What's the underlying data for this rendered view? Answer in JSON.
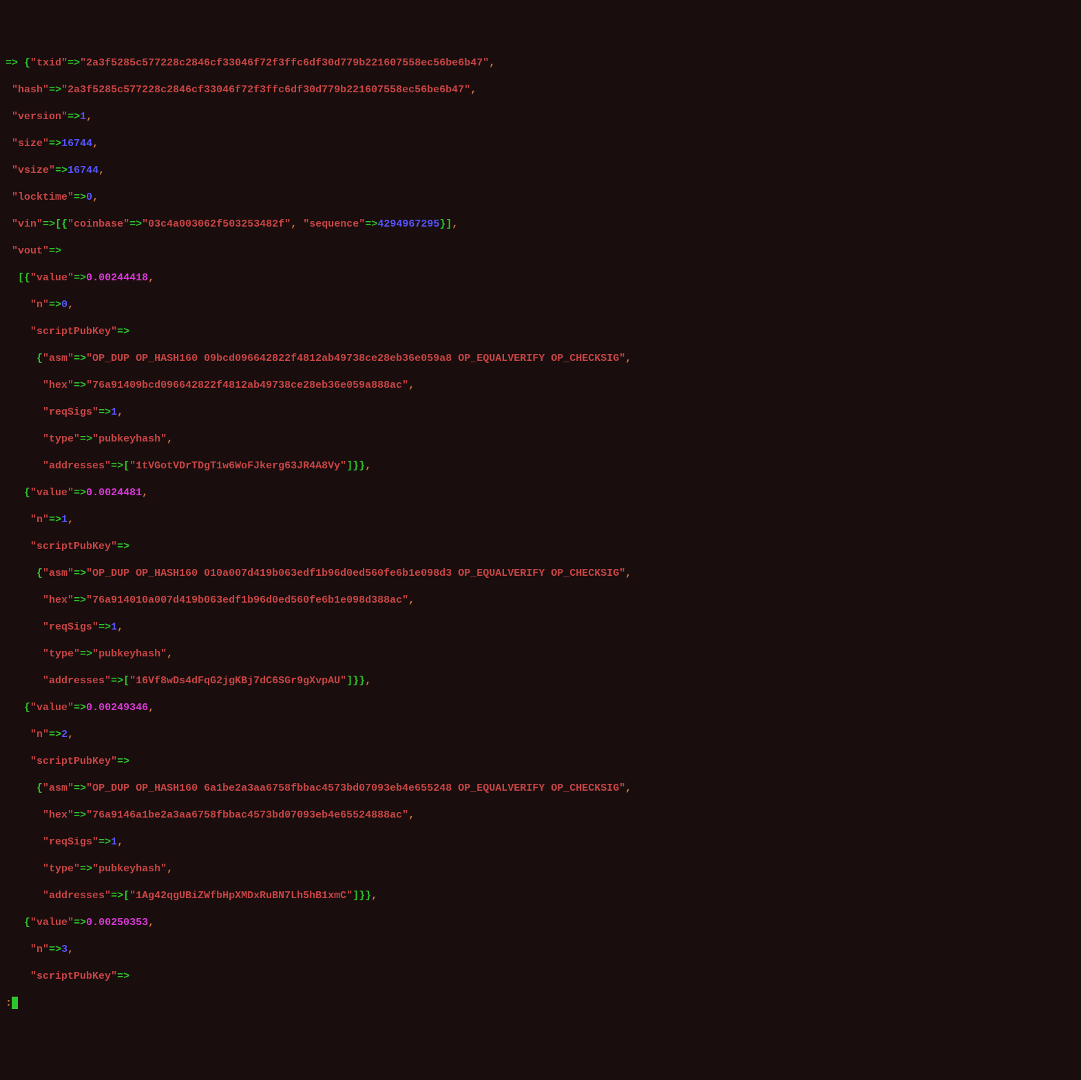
{
  "txid_key": "txid",
  "txid_val": "2a3f5285c577228c2846cf33046f72f3ffc6df30d779b221607558ec56be6b47",
  "hash_key": "hash",
  "hash_val": "2a3f5285c577228c2846cf33046f72f3ffc6df30d779b221607558ec56be6b47",
  "version_key": "version",
  "version_val": "1",
  "size_key": "size",
  "size_val": "16744",
  "vsize_key": "vsize",
  "vsize_val": "16744",
  "locktime_key": "locktime",
  "locktime_val": "0",
  "vin_key": "vin",
  "coinbase_key": "coinbase",
  "coinbase_val": "03c4a003062f503253482f",
  "sequence_key": "sequence",
  "sequence_val": "4294967295",
  "vout_key": "vout",
  "value_key": "value",
  "n_key": "n",
  "scriptPubKey_key": "scriptPubKey",
  "asm_key": "asm",
  "hex_key": "hex",
  "reqSigs_key": "reqSigs",
  "type_key": "type",
  "addresses_key": "addresses",
  "pubkeyhash": "pubkeyhash",
  "vout0_value": "0.00244418",
  "vout0_n": "0",
  "vout0_asm": "OP_DUP OP_HASH160 09bcd096642822f4812ab49738ce28eb36e059a8 OP_EQUALVERIFY OP_CHECKSIG",
  "vout0_hex": "76a91409bcd096642822f4812ab49738ce28eb36e059a888ac",
  "vout0_reqSigs": "1",
  "vout0_addr": "1tVGotVDrTDgT1w6WoFJkerg63JR4A8Vy",
  "vout1_value": "0.0024481",
  "vout1_n": "1",
  "vout1_asm": "OP_DUP OP_HASH160 010a007d419b063edf1b96d0ed560fe6b1e098d3 OP_EQUALVERIFY OP_CHECKSIG",
  "vout1_hex": "76a914010a007d419b063edf1b96d0ed560fe6b1e098d388ac",
  "vout1_reqSigs": "1",
  "vout1_addr": "16Vf8wDs4dFqG2jgKBj7dC6SGr9gXvpAU",
  "vout2_value": "0.00249346",
  "vout2_n": "2",
  "vout2_asm": "OP_DUP OP_HASH160 6a1be2a3aa6758fbbac4573bd07093eb4e655248 OP_EQUALVERIFY OP_CHECKSIG",
  "vout2_hex": "76a9146a1be2a3aa6758fbbac4573bd07093eb4e65524888ac",
  "vout2_reqSigs": "1",
  "vout2_addr": "1Ag42qgUBiZWfbHpXMDxRuBN7Lh5hB1xmC",
  "vout3_value": "0.00250353",
  "vout3_n": "3",
  "arrow": "=>",
  "prompt": ":"
}
